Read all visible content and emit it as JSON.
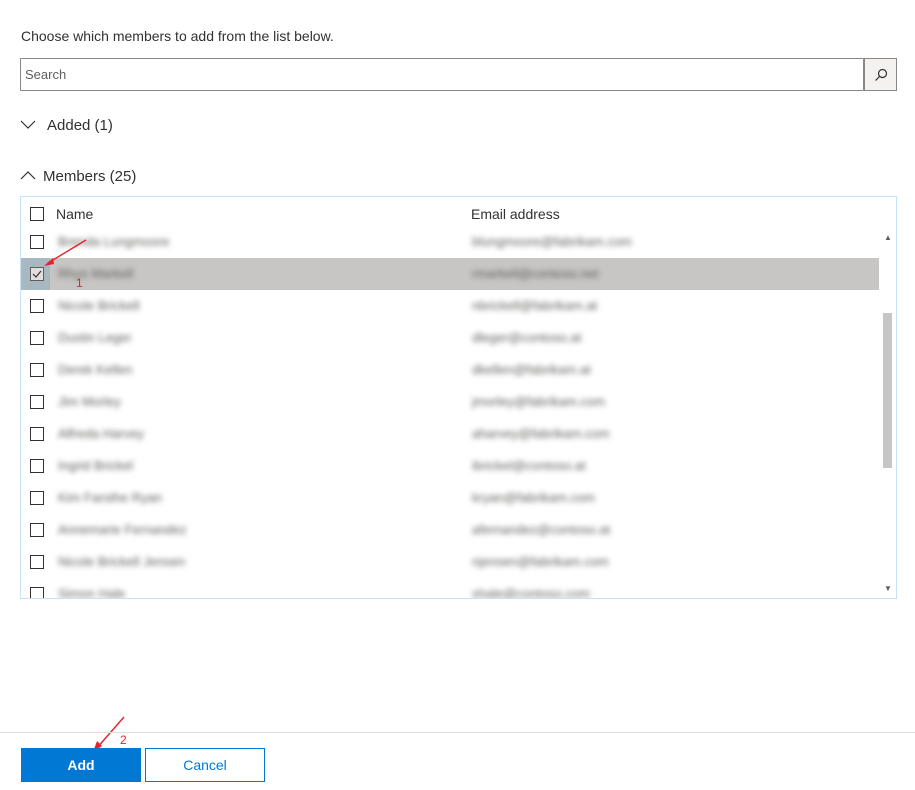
{
  "intro_text": "Choose which members to add from the list below.",
  "search": {
    "placeholder": "Search",
    "value": ""
  },
  "added_section": {
    "label": "Added (1)"
  },
  "members_section": {
    "label": "Members (25)"
  },
  "table": {
    "col_name": "Name",
    "col_email": "Email address",
    "rows": [
      {
        "name": "Brenda Lungmoore",
        "email": "blungmoore@fabrikam.com"
      },
      {
        "name": "Rhys Markell",
        "email": "rmarkell@contoso.net"
      },
      {
        "name": "Nicole Brickell",
        "email": "nbrickell@fabrikam.at"
      },
      {
        "name": "Dustin Leger",
        "email": "dleger@contoso.at"
      },
      {
        "name": "Derek Kellen",
        "email": "dkellen@fabrikam.at"
      },
      {
        "name": "Jim Morley",
        "email": "jmorley@fabrikam.com"
      },
      {
        "name": "Alfreda Harvey",
        "email": "aharvey@fabrikam.com"
      },
      {
        "name": "Ingrid Brickel",
        "email": "ibrickel@contoso.at"
      },
      {
        "name": "Kim Farsthe Ryan",
        "email": "kryan@fabrikam.com"
      },
      {
        "name": "Annemarie Fernandez",
        "email": "afernandez@contoso.at"
      },
      {
        "name": "Nicole Brickell Jensen",
        "email": "njensen@fabrikam.com"
      },
      {
        "name": "Simon Hale",
        "email": "shale@contoso.com"
      }
    ],
    "selected_index": 1
  },
  "annotations": {
    "step1": "1",
    "step2": "2"
  },
  "buttons": {
    "add": "Add",
    "cancel": "Cancel"
  },
  "colors": {
    "accent": "#0078d4",
    "selected_row": "#c8c6c4",
    "annotation": "#e8202a"
  }
}
